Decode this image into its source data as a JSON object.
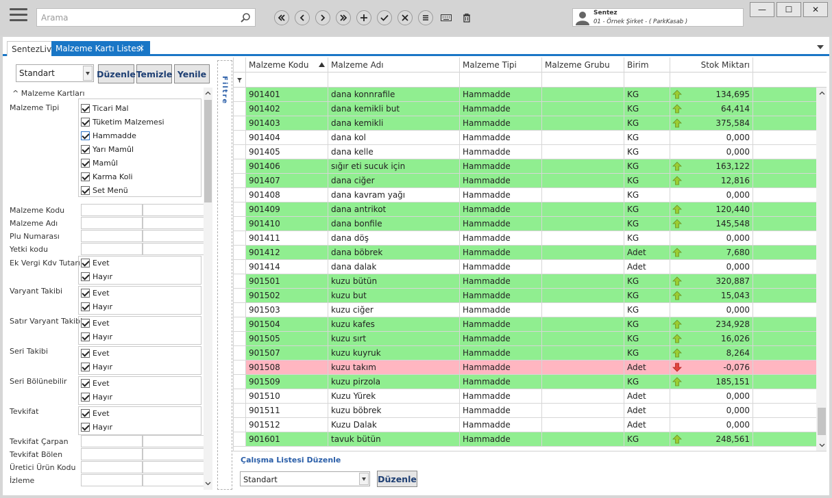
{
  "search": {
    "placeholder": "Arama"
  },
  "toolbar": {
    "buttons": [
      "first-icon",
      "previous-icon",
      "next-icon",
      "last-icon",
      "add-icon",
      "confirm-icon",
      "cancel-icon",
      "list-icon",
      "keyboard-icon",
      "delete-icon"
    ]
  },
  "user": {
    "name": "Sentez",
    "company": "01 - Örnek Şirket - ( ParkKasab )"
  },
  "window_buttons": {
    "minimize": "—",
    "maximize": "☐",
    "close": "✕"
  },
  "tabs": [
    {
      "label": "SentezLive"
    },
    {
      "label": "Malzeme Kartı Listesi",
      "close": "×"
    }
  ],
  "filter": {
    "view_select": "Standart",
    "buttons": {
      "edit": "Düzenle",
      "clear": "Temizle",
      "refresh": "Yenile"
    },
    "section": "Malzeme Kartları",
    "material_type_label": "Malzeme Tipi",
    "material_types": [
      "Ticari Mal",
      "Tüketim Malzemesi",
      "Hammadde",
      "Yarı Mamûl",
      "Mamûl",
      "Karma Koli",
      "Set Menü"
    ],
    "text_fields": [
      "Malzeme Kodu",
      "Malzeme Adı",
      "Plu Numarası",
      "Yetki kodu"
    ],
    "yes_no_fields": [
      "Ek Vergi Kdv Tutarı",
      "Varyant Takibi",
      "Satır Varyant Takibi",
      "Seri Takibi",
      "Seri Bölünebilir",
      "Tevkifat"
    ],
    "yes": "Evet",
    "no": "Hayır",
    "bottom_fields": [
      "Tevkifat Çarpan",
      "Tevkifat Bölen",
      "Üretici Ürün Kodu",
      "İzleme"
    ],
    "toggle_label": "Filtre"
  },
  "grid": {
    "columns": [
      "Malzeme Kodu",
      "Malzeme Adı",
      "Malzeme Tipi",
      "Malzeme Grubu",
      "Birim",
      "Stok Miktarı"
    ],
    "colors": {
      "positive": "#90ee90",
      "negative": "#ffb6c1",
      "zero": "#ffffff",
      "arrow_up": "#9acd32",
      "arrow_down": "#e0443e"
    },
    "rows": [
      {
        "code": "901401",
        "name": "dana konnrafile",
        "type": "Hammadde",
        "group": "",
        "unit": "KG",
        "qty": "134,695",
        "status": "up"
      },
      {
        "code": "901402",
        "name": "dana kemikli but",
        "type": "Hammadde",
        "group": "",
        "unit": "KG",
        "qty": "64,414",
        "status": "up"
      },
      {
        "code": "901403",
        "name": "dana kemikli",
        "type": "Hammadde",
        "group": "",
        "unit": "KG",
        "qty": "375,584",
        "status": "up"
      },
      {
        "code": "901404",
        "name": "dana kol",
        "type": "Hammadde",
        "group": "",
        "unit": "KG",
        "qty": "0,000",
        "status": "zero"
      },
      {
        "code": "901405",
        "name": "dana kelle",
        "type": "Hammadde",
        "group": "",
        "unit": "KG",
        "qty": "0,000",
        "status": "zero"
      },
      {
        "code": "901406",
        "name": "sığır eti sucuk için",
        "type": "Hammadde",
        "group": "",
        "unit": "KG",
        "qty": "163,122",
        "status": "up"
      },
      {
        "code": "901407",
        "name": "dana ciğer",
        "type": "Hammadde",
        "group": "",
        "unit": "KG",
        "qty": "12,816",
        "status": "up"
      },
      {
        "code": "901408",
        "name": "dana kavram yağı",
        "type": "Hammadde",
        "group": "",
        "unit": "KG",
        "qty": "0,000",
        "status": "zero"
      },
      {
        "code": "901409",
        "name": "dana antrikot",
        "type": "Hammadde",
        "group": "",
        "unit": "KG",
        "qty": "120,440",
        "status": "up"
      },
      {
        "code": "901410",
        "name": "dana bonfile",
        "type": "Hammadde",
        "group": "",
        "unit": "KG",
        "qty": "145,548",
        "status": "up"
      },
      {
        "code": "901411",
        "name": "dana döş",
        "type": "Hammadde",
        "group": "",
        "unit": "KG",
        "qty": "0,000",
        "status": "zero"
      },
      {
        "code": "901412",
        "name": "dana böbrek",
        "type": "Hammadde",
        "group": "",
        "unit": "Adet",
        "qty": "7,680",
        "status": "up"
      },
      {
        "code": "901414",
        "name": "dana dalak",
        "type": "Hammadde",
        "group": "",
        "unit": "Adet",
        "qty": "0,000",
        "status": "zero"
      },
      {
        "code": "901501",
        "name": "kuzu bütün",
        "type": "Hammadde",
        "group": "",
        "unit": "KG",
        "qty": "320,887",
        "status": "up"
      },
      {
        "code": "901502",
        "name": "kuzu but",
        "type": "Hammadde",
        "group": "",
        "unit": "KG",
        "qty": "15,043",
        "status": "up"
      },
      {
        "code": "901503",
        "name": "kuzu ciğer",
        "type": "Hammadde",
        "group": "",
        "unit": "KG",
        "qty": "0,000",
        "status": "zero"
      },
      {
        "code": "901504",
        "name": "kuzu kafes",
        "type": "Hammadde",
        "group": "",
        "unit": "KG",
        "qty": "234,928",
        "status": "up"
      },
      {
        "code": "901505",
        "name": "kuzu sırt",
        "type": "Hammadde",
        "group": "",
        "unit": "KG",
        "qty": "16,026",
        "status": "up"
      },
      {
        "code": "901507",
        "name": "kuzu kuyruk",
        "type": "Hammadde",
        "group": "",
        "unit": "KG",
        "qty": "8,264",
        "status": "up"
      },
      {
        "code": "901508",
        "name": "kuzu takım",
        "type": "Hammadde",
        "group": "",
        "unit": "Adet",
        "qty": "-0,076",
        "status": "down"
      },
      {
        "code": "901509",
        "name": "kuzu pirzola",
        "type": "Hammadde",
        "group": "",
        "unit": "KG",
        "qty": "185,151",
        "status": "up"
      },
      {
        "code": "901510",
        "name": "Kuzu Yürek",
        "type": "Hammadde",
        "group": "",
        "unit": "Adet",
        "qty": "0,000",
        "status": "zero"
      },
      {
        "code": "901511",
        "name": "kuzu böbrek",
        "type": "Hammadde",
        "group": "",
        "unit": "Adet",
        "qty": "0,000",
        "status": "zero"
      },
      {
        "code": "901512",
        "name": "Kuzu Dalak",
        "type": "Hammadde",
        "group": "",
        "unit": "Adet",
        "qty": "0,000",
        "status": "zero"
      },
      {
        "code": "901601",
        "name": "tavuk bütün",
        "type": "Hammadde",
        "group": "",
        "unit": "KG",
        "qty": "248,561",
        "status": "up"
      }
    ]
  },
  "worklist": {
    "label": "Çalışma Listesi Düzenle",
    "select": "Standart",
    "button": "Düzenle"
  }
}
